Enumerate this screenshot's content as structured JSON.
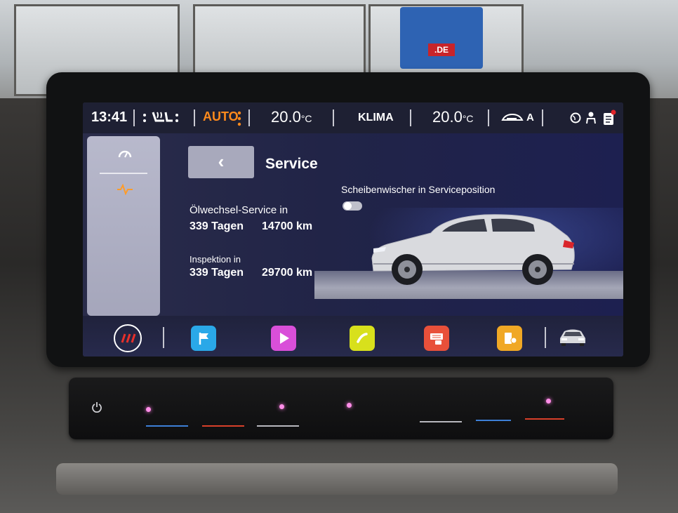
{
  "status_bar": {
    "time": "13:41",
    "auto_label": "AUTO",
    "temp_left": "20.0",
    "temp_right": "20.0",
    "temp_unit": "°C",
    "klima_label": "KLIMA",
    "recirc_label": "A"
  },
  "sidebar": {
    "items": [
      {
        "icon": "gauge-icon",
        "active": false
      },
      {
        "icon": "pulse-icon",
        "active": true
      }
    ]
  },
  "service": {
    "title": "Service",
    "back_glyph": "‹",
    "oil_label": "Ölwechsel-Service in",
    "oil_days": "339 Tagen",
    "oil_km": "14700 km",
    "inspection_label": "Inspektion in",
    "inspection_days": "339 Tagen",
    "inspection_km": "29700 km",
    "wiper_label": "Scheibenwischer in Serviceposition",
    "wiper_on": false
  },
  "dock": {
    "apps": [
      {
        "name": "navigation",
        "icon": "flag-icon",
        "color": "#2aa8e8"
      },
      {
        "name": "media",
        "icon": "play-icon",
        "color": "#d94fd9"
      },
      {
        "name": "phone",
        "icon": "phone-icon",
        "color": "#d8e01c"
      },
      {
        "name": "apps",
        "icon": "apps-icon",
        "color": "#e8503a"
      },
      {
        "name": "vehicle",
        "icon": "fuel-icon",
        "color": "#f0a825"
      }
    ],
    "home_label": "///"
  },
  "environment": {
    "sign_text": ".DE"
  },
  "colors": {
    "accent_orange": "#ff8a1c",
    "screen_bg": "#21244a"
  }
}
